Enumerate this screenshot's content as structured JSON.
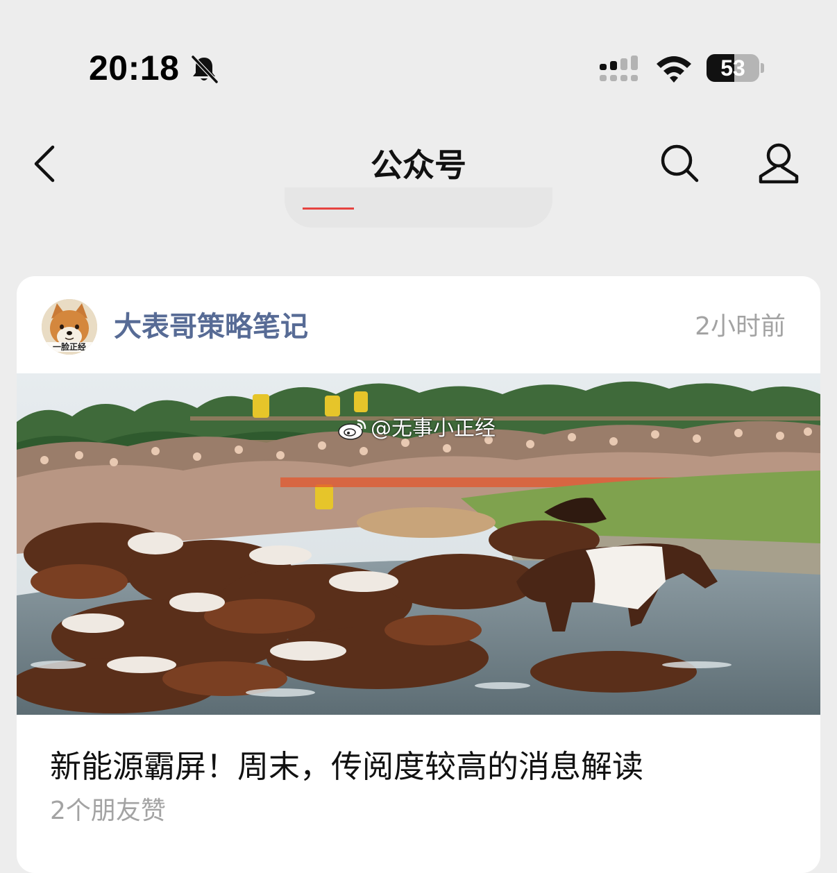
{
  "status_bar": {
    "time": "20:18",
    "battery_level": "53",
    "battery_fraction": 0.53,
    "icons": [
      "bell-muted-icon",
      "cellular-signal-icon",
      "wifi-icon",
      "battery-icon"
    ]
  },
  "nav": {
    "title": "公众号",
    "back_icon": "chevron-left-icon",
    "search_icon": "search-icon",
    "profile_icon": "person-icon"
  },
  "article_card": {
    "account_name": "大表哥策略笔记",
    "avatar_caption": "一脸正经",
    "time_ago": "2小时前",
    "cover_watermark": "@无事小正经",
    "watermark_icon": "weibo-icon",
    "title": "新能源霸屏！周末，传阅度较高的消息解读",
    "likes_text": "2个朋友赞"
  },
  "colors": {
    "background": "#ededed",
    "card": "#ffffff",
    "account_name": "#576b95",
    "secondary_text": "#a3a3a3",
    "accent_red": "#e64340"
  }
}
